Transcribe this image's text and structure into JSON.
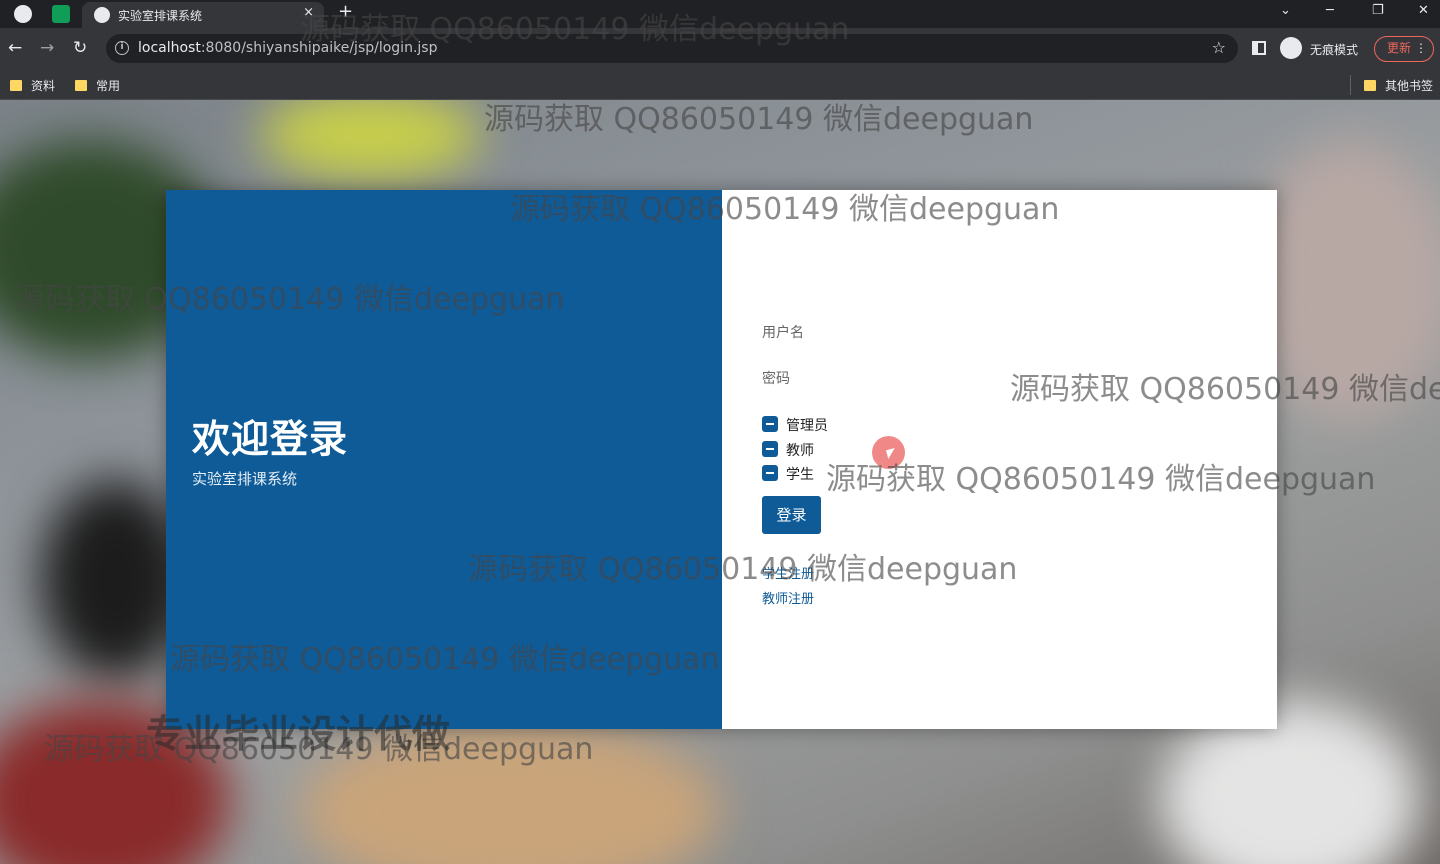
{
  "browser": {
    "tab_title": "实验室排课系统",
    "tab_close": "×",
    "new_tab": "+",
    "url_host": "localhost",
    "url_rest": ":8080/shiyanshipaike/jsp/login.jsp",
    "incognito_label": "无痕模式",
    "update_label": "更新",
    "bookmarks": [
      "资料",
      "常用"
    ],
    "other_bookmarks": "其他书签",
    "window_controls": [
      "⌄",
      "─",
      "❐",
      "✕"
    ]
  },
  "login": {
    "welcome": "欢迎登录",
    "subtitle": "实验室排课系统",
    "username_placeholder": "用户名",
    "password_placeholder": "密码",
    "roles": [
      "管理员",
      "教师",
      "学生"
    ],
    "login_button": "登录",
    "student_register": "学生注册",
    "teacher_register": "教师注册"
  },
  "watermark": {
    "text": "源码获取 QQ86050149 微信deepguan",
    "banner": "专业毕业设计代做"
  },
  "colors": {
    "accent": "#0e5b98",
    "card_right": "#ffffff"
  }
}
